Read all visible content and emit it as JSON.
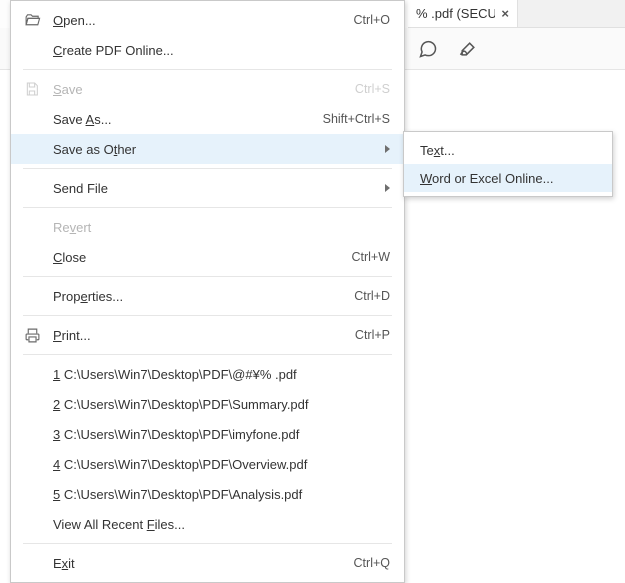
{
  "tab": {
    "label": "% .pdf (SECU..."
  },
  "menu": {
    "open": {
      "label": "Open...",
      "shortcut": "Ctrl+O"
    },
    "create_online": {
      "label": "Create PDF Online..."
    },
    "save": {
      "label": "Save",
      "shortcut": "Ctrl+S"
    },
    "save_as": {
      "pre": "Save ",
      "mn": "A",
      "post": "s...",
      "shortcut": "Shift+Ctrl+S"
    },
    "save_other": {
      "pre": "Save as O",
      "mn": "t",
      "post": "her"
    },
    "send_file": {
      "label": "Send File"
    },
    "revert": {
      "pre": "Re",
      "mn": "v",
      "post": "ert"
    },
    "close": {
      "label": "Close",
      "shortcut": "Ctrl+W"
    },
    "properties": {
      "pre": "Prop",
      "mn": "e",
      "post": "rties...",
      "shortcut": "Ctrl+D"
    },
    "print": {
      "label": "Print...",
      "shortcut": "Ctrl+P"
    },
    "recents": [
      {
        "n": "1",
        "path": "C:\\Users\\Win7\\Desktop\\PDF\\@#¥% .pdf"
      },
      {
        "n": "2",
        "path": "C:\\Users\\Win7\\Desktop\\PDF\\Summary.pdf"
      },
      {
        "n": "3",
        "path": "C:\\Users\\Win7\\Desktop\\PDF\\imyfone.pdf"
      },
      {
        "n": "4",
        "path": "C:\\Users\\Win7\\Desktop\\PDF\\Overview.pdf"
      },
      {
        "n": "5",
        "path": "C:\\Users\\Win7\\Desktop\\PDF\\Analysis.pdf"
      }
    ],
    "view_all": {
      "pre": "View All Recent ",
      "mn": "F",
      "post": "iles..."
    },
    "exit": {
      "pre": "E",
      "mn": "x",
      "post": "it",
      "shortcut": "Ctrl+Q"
    }
  },
  "submenu": {
    "text": {
      "pre": "Te",
      "mn": "x",
      "post": "t..."
    },
    "word_excel": {
      "label": "Word or Excel Online..."
    }
  }
}
